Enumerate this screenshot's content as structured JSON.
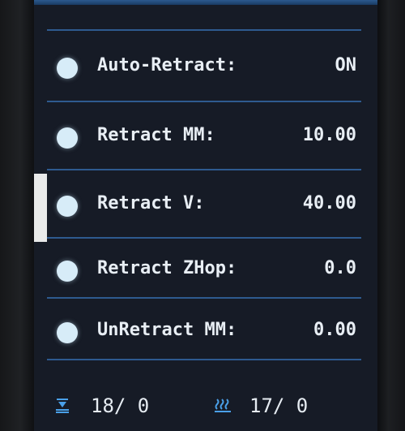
{
  "menu": {
    "items": [
      {
        "label": "Auto-Retract:",
        "value": "ON"
      },
      {
        "label": "Retract MM:",
        "value": "10.00"
      },
      {
        "label": "Retract V:",
        "value": "40.00"
      },
      {
        "label": "Retract ZHop:",
        "value": "0.0"
      },
      {
        "label": "UnRetract MM:",
        "value": "0.00"
      }
    ]
  },
  "status": {
    "nozzle": "18/  0",
    "bed": "17/  0",
    "nozzle_icon": "nozzle-temp-icon",
    "bed_icon": "bed-temp-icon"
  },
  "colors": {
    "background": "#161b26",
    "divider": "#2e5a8f",
    "text": "#e8eef4",
    "icon": "#4aa0e8"
  }
}
